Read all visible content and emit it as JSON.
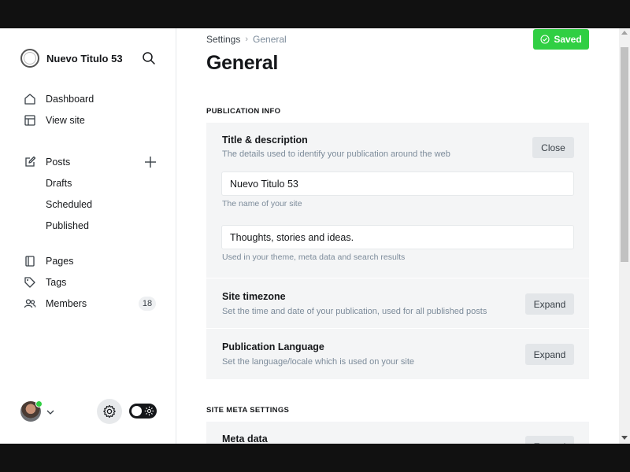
{
  "sidebar": {
    "site_name": "Nuevo Titulo 53",
    "nav_top": [
      {
        "label": "Dashboard",
        "icon": "home-icon"
      },
      {
        "label": "View site",
        "icon": "layout-icon"
      }
    ],
    "posts": {
      "label": "Posts",
      "icon": "edit-icon",
      "sub": [
        "Drafts",
        "Scheduled",
        "Published"
      ]
    },
    "nav_bottom": [
      {
        "label": "Pages",
        "icon": "page-icon"
      },
      {
        "label": "Tags",
        "icon": "tag-icon"
      },
      {
        "label": "Members",
        "icon": "members-icon",
        "count": "18"
      }
    ]
  },
  "main": {
    "breadcrumb": {
      "parent": "Settings",
      "separator": "›",
      "current": "General"
    },
    "saved_label": "Saved",
    "title": "General",
    "publication_info": {
      "section_label": "PUBLICATION INFO",
      "title_desc": {
        "title": "Title & description",
        "description": "The details used to identify your publication around the web",
        "button": "Close",
        "site_title_value": "Nuevo Titulo 53",
        "site_title_hint": "The name of your site",
        "site_desc_value": "Thoughts, stories and ideas.",
        "site_desc_hint": "Used in your theme, meta data and search results"
      },
      "timezone": {
        "title": "Site timezone",
        "description": "Set the time and date of your publication, used for all published posts",
        "button": "Expand"
      },
      "language": {
        "title": "Publication Language",
        "description": "Set the language/locale which is used on your site",
        "button": "Expand"
      }
    },
    "site_meta": {
      "section_label": "SITE META SETTINGS",
      "meta_data": {
        "title": "Meta data",
        "button": "Expand"
      }
    }
  },
  "colors": {
    "accent_green": "#30cf43",
    "panel_bg": "#f4f5f6",
    "text_dark": "#15171a",
    "text_muted": "#7c8b9a"
  }
}
